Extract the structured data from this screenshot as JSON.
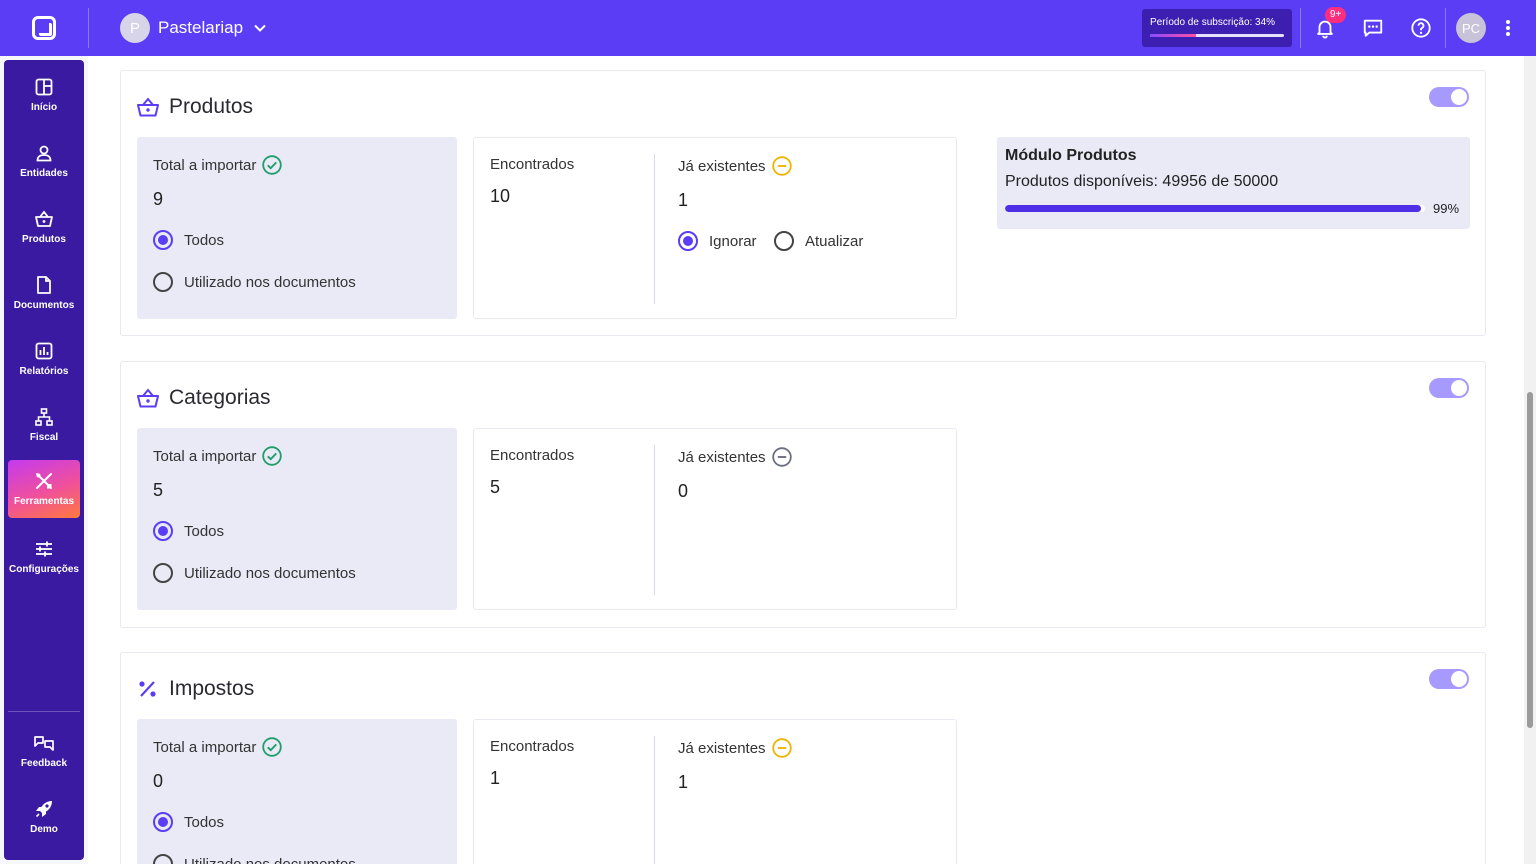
{
  "header": {
    "workspace_initial": "P",
    "workspace_name": "Pastelariap",
    "subscription_label": "Período de subscrição: 34%",
    "subscription_progress": 0.34,
    "notifications_badge": "9+",
    "user_initials": "PC"
  },
  "sidebar": {
    "items": [
      {
        "label": "Início",
        "icon": "dashboard-icon"
      },
      {
        "label": "Entidades",
        "icon": "user-icon"
      },
      {
        "label": "Produtos",
        "icon": "basket-icon"
      },
      {
        "label": "Documentos",
        "icon": "document-icon"
      },
      {
        "label": "Relatórios",
        "icon": "report-icon"
      },
      {
        "label": "Fiscal",
        "icon": "fiscal-icon"
      },
      {
        "label": "Ferramentas",
        "icon": "tools-icon",
        "active": true
      },
      {
        "label": "Configurações",
        "icon": "settings-sliders-icon"
      }
    ],
    "bottom": [
      {
        "label": "Feedback",
        "icon": "feedback-icon"
      },
      {
        "label": "Demo",
        "icon": "rocket-icon"
      }
    ]
  },
  "sections": [
    {
      "title": "Produtos",
      "icon": "basket-icon",
      "enabled": true,
      "total_label": "Total a importar",
      "total_value": "9",
      "option_all": "Todos",
      "option_used": "Utilizado nos documentos",
      "found_label": "Encontrados",
      "found_value": "10",
      "existing_label": "Já existentes",
      "existing_value": "1",
      "existing_status_color": "#f0b400",
      "action_ignore": "Ignorar",
      "action_update": "Atualizar"
    },
    {
      "title": "Categorias",
      "icon": "basket-icon",
      "enabled": true,
      "total_label": "Total a importar",
      "total_value": "5",
      "option_all": "Todos",
      "option_used": "Utilizado nos documentos",
      "found_label": "Encontrados",
      "found_value": "5",
      "existing_label": "Já existentes",
      "existing_value": "0",
      "existing_status_color": "#6b6f80"
    },
    {
      "title": "Impostos",
      "icon": "percent-icon",
      "enabled": true,
      "total_label": "Total a importar",
      "total_value": "0",
      "option_all": "Todos",
      "option_used": "Utilizado nos documentos",
      "found_label": "Encontrados",
      "found_value": "1",
      "existing_label": "Já existentes",
      "existing_value": "1",
      "existing_status_color": "#f0b400"
    }
  ],
  "module": {
    "title": "Módulo Produtos",
    "subtitle": "Produtos disponíveis: 49956 de 50000",
    "percent_label": "99%",
    "progress": 0.99
  },
  "colors": {
    "brand": "#5b3df5",
    "sidebar": "#3a1aa0",
    "success": "#1f9d6b",
    "warning": "#f0b400"
  }
}
